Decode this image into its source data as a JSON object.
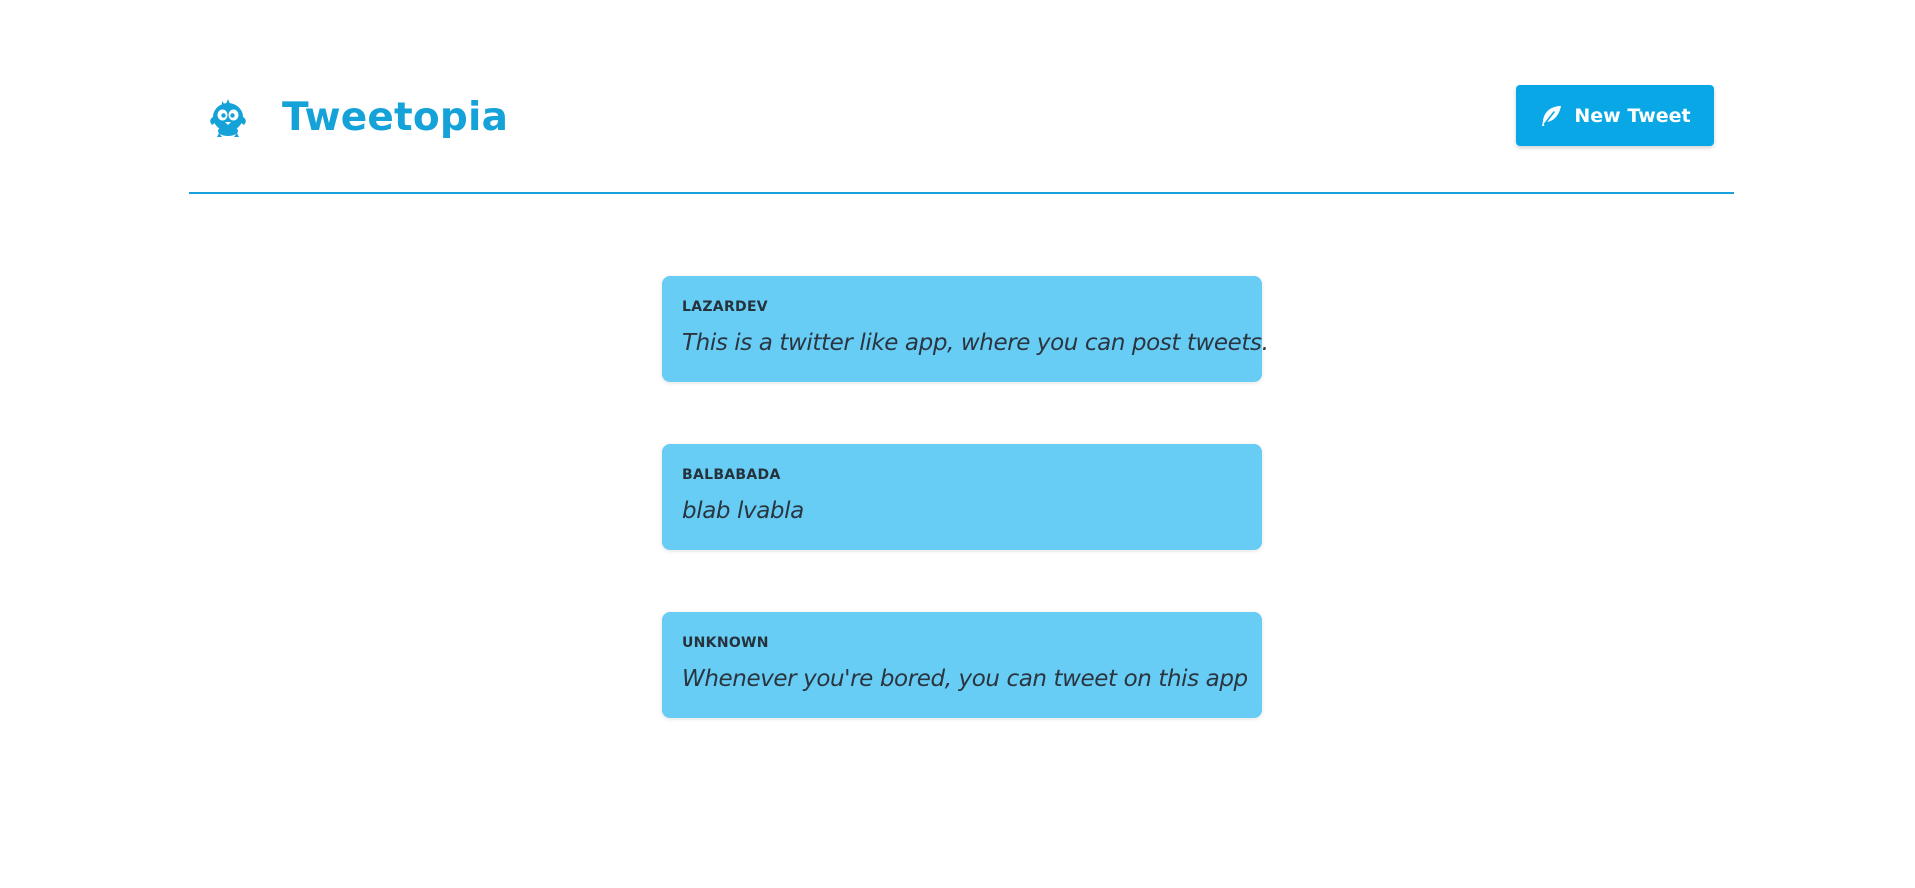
{
  "app": {
    "title": "Tweetopia",
    "brand_color": "#14a2d8",
    "logo_icon": "bird-mascot-icon"
  },
  "header": {
    "new_tweet_label": "New Tweet",
    "new_tweet_icon": "feather-icon",
    "accent_color": "#0aa7e6"
  },
  "feed": {
    "card_color": "#67cdf5",
    "tweets": [
      {
        "author": "LAZARDEV",
        "text": "This is a twitter like app, where you can post tweets."
      },
      {
        "author": "BALBABADA",
        "text": "blab lvabla"
      },
      {
        "author": "UNKNOWN",
        "text": "Whenever you're bored, you can tweet on this app"
      }
    ]
  }
}
